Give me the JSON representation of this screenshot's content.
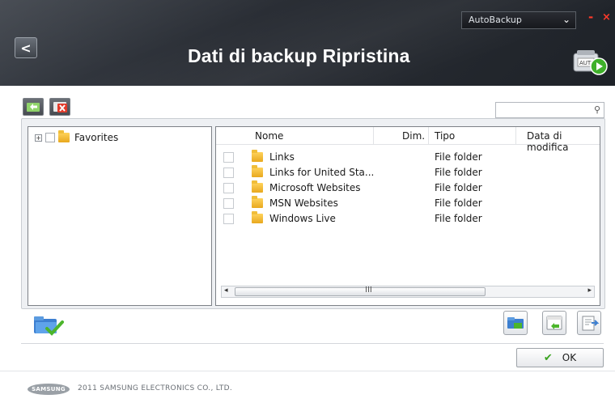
{
  "header": {
    "title": "Dati di backup Ripristina",
    "mode_selector": "AutoBackup",
    "minimize": "-",
    "close": "×",
    "back": "<"
  },
  "toolbar": {
    "search_placeholder": ""
  },
  "tree": {
    "items": [
      {
        "label": "Favorites",
        "expander": "+"
      }
    ]
  },
  "file_list": {
    "columns": [
      "Nome",
      "Dim.",
      "Tipo",
      "Data di modifica"
    ],
    "rows": [
      {
        "name": "Links",
        "size": "",
        "type": "File folder",
        "modified": ""
      },
      {
        "name": "Links for United Sta...",
        "size": "",
        "type": "File folder",
        "modified": ""
      },
      {
        "name": "Microsoft Websites",
        "size": "",
        "type": "File folder",
        "modified": ""
      },
      {
        "name": "MSN Websites",
        "size": "",
        "type": "File folder",
        "modified": ""
      },
      {
        "name": "Windows Live",
        "size": "",
        "type": "File folder",
        "modified": ""
      }
    ],
    "scroll_grip": "III",
    "scroll_left": "◂",
    "scroll_right": "▸"
  },
  "actions": {
    "ok_label": "OK",
    "ok_icon": "✔"
  },
  "footer": {
    "logo": "SAMSUNG",
    "copyright": "2011 SAMSUNG ELECTRONICS CO., LTD."
  },
  "colors": {
    "header_bg": "#2a2e35",
    "close_red": "#ff3a2a",
    "ok_green": "#3aa320",
    "folder_yellow": "#f0be3a"
  }
}
